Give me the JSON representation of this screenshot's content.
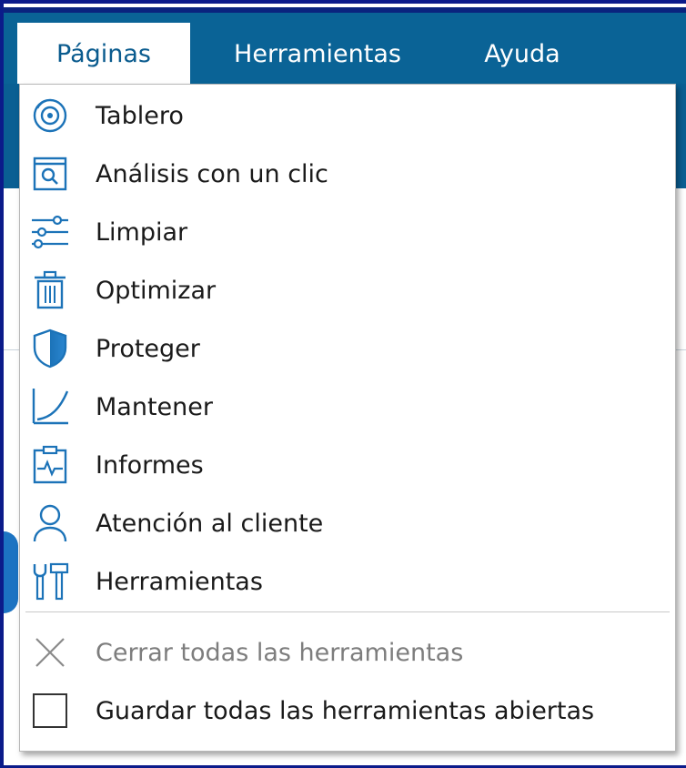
{
  "menubar": {
    "tabs": [
      {
        "label": "Páginas"
      },
      {
        "label": "Herramientas"
      },
      {
        "label": "Ayuda"
      }
    ]
  },
  "dropdown": {
    "items": [
      {
        "label": "Tablero",
        "icon": "dashboard-icon"
      },
      {
        "label": "Análisis con un clic",
        "icon": "scan-icon"
      },
      {
        "label": "Limpiar",
        "icon": "sliders-icon"
      },
      {
        "label": "Optimizar",
        "icon": "trash-icon"
      },
      {
        "label": "Proteger",
        "icon": "shield-icon"
      },
      {
        "label": "Mantener",
        "icon": "chart-curve-icon"
      },
      {
        "label": "Informes",
        "icon": "report-icon"
      },
      {
        "label": "Atención al cliente",
        "icon": "person-icon"
      },
      {
        "label": "Herramientas",
        "icon": "tools-icon"
      }
    ],
    "close_all": {
      "label": "Cerrar todas las herramientas",
      "icon": "close-icon"
    },
    "save_all": {
      "label": "Guardar todas las herramientas abiertas",
      "icon": "checkbox-icon"
    }
  },
  "colors": {
    "accent": "#0a6396",
    "icon": "#1c73b8",
    "frame": "#0b1b8a"
  }
}
